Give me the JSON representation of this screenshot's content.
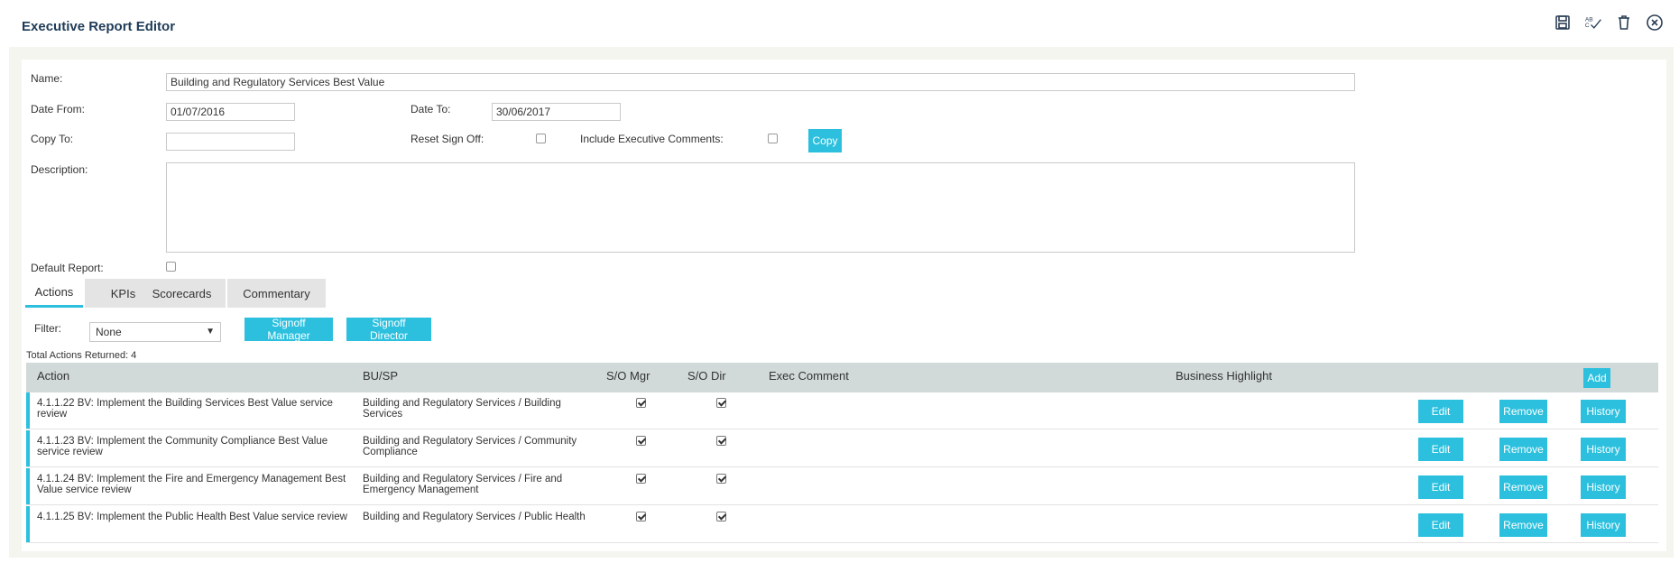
{
  "header": {
    "title": "Executive Report Editor",
    "icons": [
      "save-icon",
      "spellcheck-icon",
      "trash-icon",
      "close-circle-icon"
    ],
    "spellcheck_text": "AB C"
  },
  "form": {
    "name_label": "Name:",
    "name_value": "Building and Regulatory Services Best Value",
    "date_from_label": "Date From:",
    "date_from_value": "01/07/2016",
    "date_to_label": "Date To:",
    "date_to_value": "30/06/2017",
    "copy_to_label": "Copy To:",
    "copy_to_value": "",
    "reset_signoff_label": "Reset Sign Off:",
    "include_exec_comments_label": "Include Executive Comments:",
    "copy_button": "Copy",
    "description_label": "Description:",
    "description_value": "",
    "default_report_label": "Default Report:"
  },
  "tabs": [
    {
      "label": "Actions",
      "active": true
    },
    {
      "label": "KPIs",
      "active": false
    },
    {
      "label": "Scorecards",
      "active": false
    },
    {
      "label": "Commentary",
      "active": false
    }
  ],
  "filter": {
    "label": "Filter:",
    "selected": "None",
    "signoff_manager": "Signoff Manager",
    "signoff_director": "Signoff Director"
  },
  "total_actions": "Total Actions Returned: 4",
  "table": {
    "headers": {
      "action": "Action",
      "bu_sp": "BU/SP",
      "so_mgr": "S/O Mgr",
      "so_dir": "S/O Dir",
      "exec_comment": "Exec Comment",
      "business_highlight": "Business Highlight",
      "add": "Add"
    },
    "rows": [
      {
        "action": "4.1.1.22 BV: Implement the Building Services Best Value service review",
        "bu_sp": "Building and Regulatory Services / Building Services",
        "so_mgr": true,
        "so_dir": true
      },
      {
        "action": "4.1.1.23 BV: Implement the Community Compliance Best Value service review",
        "bu_sp": "Building and Regulatory Services / Community Compliance",
        "so_mgr": true,
        "so_dir": true
      },
      {
        "action": "4.1.1.24 BV: Implement the Fire and Emergency Management Best Value service review",
        "bu_sp": "Building and Regulatory Services / Fire and Emergency Management",
        "so_mgr": true,
        "so_dir": true
      },
      {
        "action": "4.1.1.25 BV: Implement the Public Health Best Value service review",
        "bu_sp": "Building and Regulatory Services / Public Health",
        "so_mgr": true,
        "so_dir": true
      }
    ],
    "row_buttons": {
      "edit": "Edit",
      "remove": "Remove",
      "history": "History"
    }
  },
  "colors": {
    "accent": "#2cc0de",
    "title": "#1f3b57",
    "table_header": "#d1d9d9"
  }
}
